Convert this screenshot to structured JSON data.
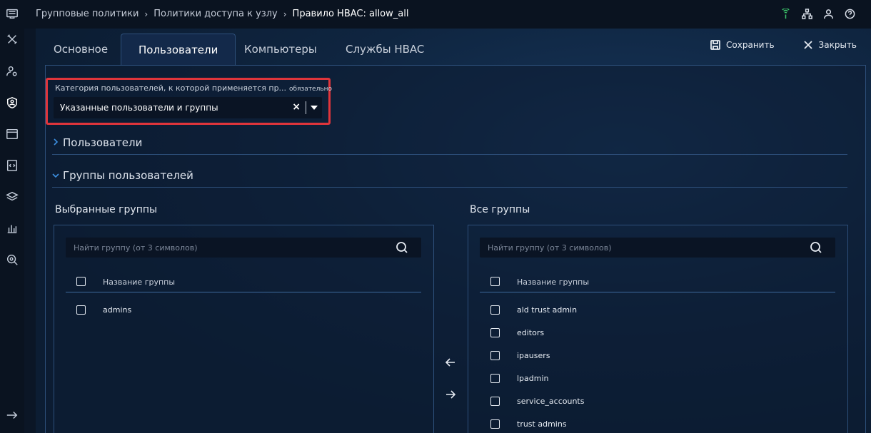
{
  "breadcrumb": {
    "items": [
      "Групповые политики",
      "Политики доступа к узлу"
    ],
    "current": "Правило HBAC: allow_all"
  },
  "tabs": [
    {
      "label": "Основное",
      "active": false
    },
    {
      "label": "Пользователи",
      "active": true
    },
    {
      "label": "Компьютеры",
      "active": false
    },
    {
      "label": "Службы HBAC",
      "active": false
    }
  ],
  "toolbar": {
    "save_label": "Сохранить",
    "close_label": "Закрыть"
  },
  "category": {
    "label": "Категория пользователей, к которой применяется пр...",
    "required_label": "обязательно",
    "value": "Указанные пользователи и группы"
  },
  "sections": {
    "users": {
      "label": "Пользователи",
      "expanded": false
    },
    "groups": {
      "label": "Группы пользователей",
      "expanded": true
    }
  },
  "selected_groups": {
    "title": "Выбранные группы",
    "search_placeholder": "Найти группу (от 3 символов)",
    "column_header": "Название группы",
    "rows": [
      "admins"
    ]
  },
  "all_groups": {
    "title": "Все группы",
    "search_placeholder": "Найти группу (от 3 символов)",
    "column_header": "Название группы",
    "rows": [
      "ald trust admin",
      "editors",
      "ipausers",
      "lpadmin",
      "service_accounts",
      "trust admins"
    ]
  },
  "colors": {
    "highlight": "#e0353b",
    "accent": "#3d8fe0",
    "status_ok": "#3cc26a"
  }
}
